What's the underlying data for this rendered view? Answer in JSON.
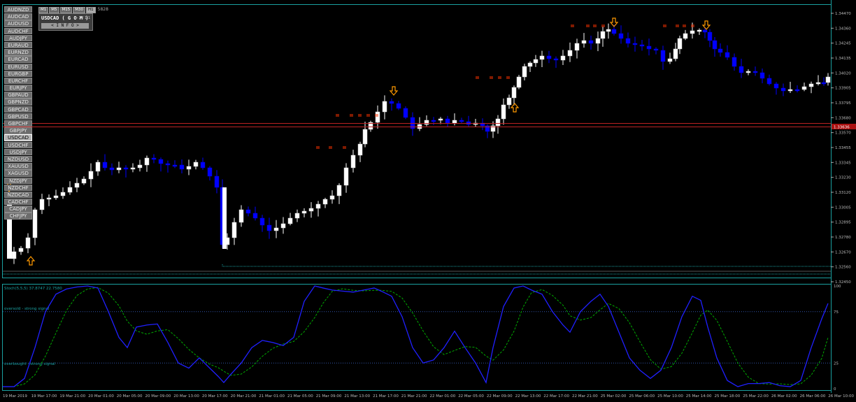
{
  "symbols": [
    "AUDNZD",
    "AUDCAD",
    "AUDUSD",
    "AUDCHF",
    "AUDJPY",
    "EURAUD",
    "EURNZD",
    "EURCAD",
    "EURUSD",
    "EURGBP",
    "EURCHF",
    "EURJPY",
    "GBPAUD",
    "GBPNZD",
    "GBPCAD",
    "GBPUSD",
    "GBPCHF",
    "GBPJPY",
    "USDCAD",
    "USDCHF",
    "USDJPY",
    "NZDUSD",
    "XAUUSD",
    "XAGUSD",
    "NZDJPY",
    "NZDCHF",
    "NZDCAD",
    "CADCHF",
    "CADJPY",
    "CHFJPY"
  ],
  "active_symbol": "USDCAD",
  "timeframes": [
    "M1",
    "M5",
    "M15",
    "M30",
    "H1"
  ],
  "active_timeframe": "H1",
  "timeframe_extra": "5828",
  "info": {
    "title": "USDCAD ( G O M )",
    "spread": "- 2 / 1 1",
    "button": "< I N F O >"
  },
  "price_axis": {
    "labels": [
      "1.34470",
      "1.34360",
      "1.34245",
      "1.34135",
      "1.34020",
      "1.33905",
      "1.33795",
      "1.33680",
      "1.33570",
      "1.33455",
      "1.33345",
      "1.33230",
      "1.33120",
      "1.33005",
      "1.32895",
      "1.32780",
      "1.32670",
      "1.32560",
      "1.32450"
    ],
    "current_price": "1.33636"
  },
  "time_axis": [
    "19 Mar 2019",
    "19 Mar 17:00",
    "19 Mar 21:00",
    "20 Mar 01:00",
    "20 Mar 05:00",
    "20 Mar 09:00",
    "20 Mar 13:00",
    "20 Mar 17:00",
    "20 Mar 21:00",
    "21 Mar 01:00",
    "21 Mar 05:00",
    "21 Mar 09:00",
    "21 Mar 13:00",
    "21 Mar 17:00",
    "21 Mar 21:00",
    "22 Mar 01:00",
    "22 Mar 05:00",
    "22 Mar 09:00",
    "22 Mar 13:00",
    "22 Mar 17:00",
    "22 Mar 21:00",
    "25 Mar 02:00",
    "25 Mar 06:00",
    "25 Mar 10:00",
    "25 Mar 14:00",
    "25 Mar 18:00",
    "25 Mar 22:00",
    "26 Mar 02:00",
    "26 Mar 06:00",
    "26 Mar 10:00"
  ],
  "stochastic": {
    "header": "Stoch(5,5,5) 37.8747 22.7580",
    "oversold_label": "oversold - strong signal",
    "overbought_label": "overbought - strong signal",
    "scale": [
      "100",
      "75",
      "25",
      "0"
    ]
  },
  "colors": {
    "bull": "#ffffff",
    "bear": "#0000ff",
    "stoch_main": "#2020ff",
    "stoch_signal": "#00aa00",
    "arrow": "#ff9900",
    "level_marker": "#ff3300",
    "grid": "#1aa0a0"
  }
}
